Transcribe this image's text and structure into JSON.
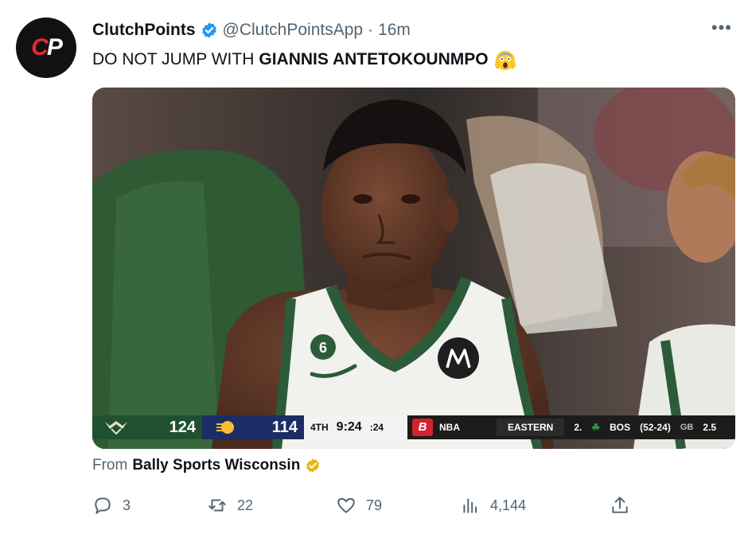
{
  "tweet": {
    "author": {
      "avatar_text": "CP",
      "display_name": "ClutchPoints",
      "handle": "@ClutchPointsApp",
      "separator": "·",
      "time": "16m"
    },
    "more_label": "•••",
    "text_plain": "DO NOT JUMP WITH",
    "text_bold": "GIANNIS ANTETOKOUNMPO",
    "emoji_icon": "screaming-face-icon",
    "media": {
      "scorebug": {
        "home_score": "124",
        "away_score": "114",
        "quarter": "4TH",
        "clock": "9:24",
        "shot_clock": ":24",
        "network": "NBA",
        "conference": "EASTERN",
        "rank": "2.",
        "team": "BOS",
        "record": "(52-24)",
        "gb_label": "GB",
        "gb_value": "2.5"
      }
    },
    "source": {
      "prefix": "From",
      "name": "Bally Sports Wisconsin"
    },
    "actions": {
      "replies": "3",
      "retweets": "22",
      "likes": "79",
      "views": "4,144"
    }
  },
  "colors": {
    "verified_blue": "#1d9bf0",
    "gold": "#e2b719",
    "text_secondary": "#536471",
    "bucks_green": "#1f5130",
    "pacers_navy": "#1b2d64"
  }
}
